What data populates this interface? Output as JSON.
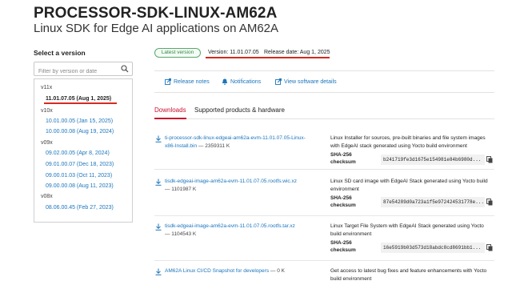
{
  "header": {
    "title": "PROCESSOR-SDK-LINUX-AM62A",
    "subtitle": "Linux SDK for Edge AI applications on AM62A"
  },
  "sidebar": {
    "heading": "Select a version",
    "filter_placeholder": "Filter by version or date",
    "groups": [
      {
        "label": "v11x",
        "items": [
          {
            "label": "11.01.07.05 (Aug 1, 2025)",
            "selected": true
          }
        ]
      },
      {
        "label": "v10x",
        "items": [
          {
            "label": "10.01.00.05 (Jan 15, 2025)"
          },
          {
            "label": "10.00.00.08 (Aug 19, 2024)"
          }
        ]
      },
      {
        "label": "v09x",
        "items": [
          {
            "label": "09.02.00.05 (Apr 8, 2024)"
          },
          {
            "label": "09.01.00.07 (Dec 18, 2023)"
          },
          {
            "label": "09.00.01.03 (Oct 11, 2023)"
          },
          {
            "label": "09.00.00.08 (Aug 11, 2023)"
          }
        ]
      },
      {
        "label": "v08x",
        "items": [
          {
            "label": "08.06.00.45 (Feb 27, 2023)"
          }
        ]
      }
    ]
  },
  "version_bar": {
    "badge": "Latest version",
    "version": "Version: 11.01.07.05",
    "release_date": "Release date: Aug 1, 2025"
  },
  "links": {
    "release_notes": "Release notes",
    "notifications": "Notifications",
    "view_software_details": "View software details"
  },
  "tabs": {
    "downloads": "Downloads",
    "supported": "Supported products & hardware"
  },
  "downloads": [
    {
      "name": "ti-processor-sdk-linux-edgeai-am62a-evm-11.01.07.05-Linux-x86-Install.bin",
      "size": "— 2359311 K",
      "description": "Linux Installer for sources, pre-built binaries and file system images with EdgeAI stack generated using Yocto build environment",
      "sha_label": "SHA-256 checksum",
      "sha": "b241719fe3d1675e154981e84b6980d..."
    },
    {
      "name": "tisdk-edgeai-image-am62a-evm-11.01.07.05.rootfs.wic.xz",
      "size": "— 1101987 K",
      "description": "Linux SD card image with EdgeAI Stack generated using Yocto build environment",
      "sha_label": "SHA-256 checksum",
      "sha": "87e54289d0a723a1f5e972424531778e..."
    },
    {
      "name": "tisdk-edgeai-image-am62a-evm-11.01.07.05.rootfs.tar.xz",
      "size": "— 1104543 K",
      "description": "Linux Target File System with EdgeAI Stack generated using Yocto build environment",
      "sha_label": "SHA-256 checksum",
      "sha": "16e5919b03d573d18abdc8cd8691bb1..."
    },
    {
      "name": "AM62A Linux CI/CD Snapshot for developers",
      "size": "— 0 K",
      "description": "Get access to latest bug fixes and feature enhancements with Yocto build environment"
    }
  ],
  "colors": {
    "link": "#1b75bc",
    "accent_red": "#c8102e",
    "annotation_red": "#d62a1e",
    "badge_green": "#2f8a44"
  }
}
